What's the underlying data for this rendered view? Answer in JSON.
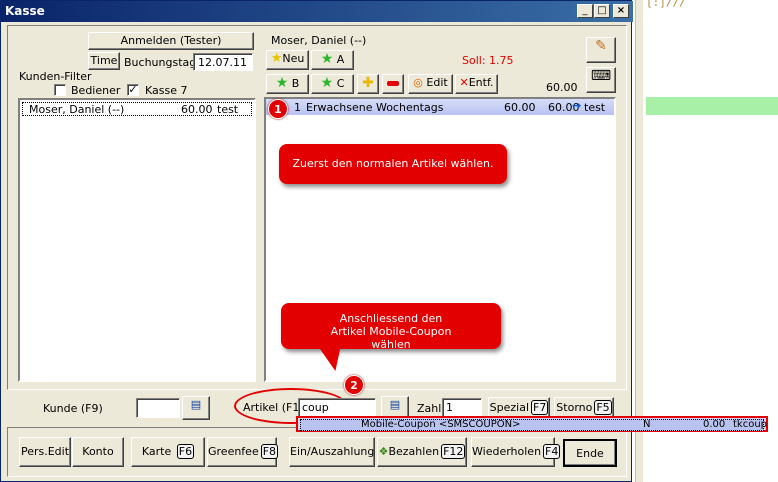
{
  "window": {
    "title": "Kasse",
    "controls": [
      "_",
      "□",
      "×"
    ]
  },
  "background_text": "[:]///",
  "left": {
    "anmelden_label": "Anmelden (Tester)",
    "time_label": "Time",
    "buchungstag_label": "Buchungstag",
    "buchungstag_value": "12.07.11",
    "kunden_filter_label": "Kunden-Filter",
    "bediener_label": "Bediener",
    "bediener_checked": false,
    "kasse_label": "Kasse 7",
    "kasse_checked": true,
    "customers": [
      {
        "name": "Moser, Daniel (--)",
        "amount": "60.00",
        "user": "test"
      }
    ]
  },
  "right": {
    "customer_name": "Moser, Daniel (--)",
    "soll_label": "Soll: 1.75",
    "total": "60.00",
    "buttons": {
      "neu": "Neu",
      "a": "A",
      "b": "B",
      "c": "C",
      "edit": "Edit",
      "entf": "Entf."
    },
    "items": [
      {
        "qty": "1",
        "name": "Erwachsene Wochentags",
        "price": "60.00",
        "total": "60.00",
        "user": "test"
      }
    ]
  },
  "annotations": {
    "bubble1": "Zuerst den normalen Artikel wählen.",
    "bubble2": "Anschliessend den Artikel Mobile-Coupon wählen",
    "badge1": "1",
    "badge2": "2"
  },
  "input_row": {
    "kunde_label": "Kunde (F9)",
    "kunde_value": "",
    "artikel_label": "Artikel (F1)",
    "artikel_value": "coup",
    "zahl_label": "Zahl",
    "zahl_value": "1",
    "spezial_label": "Spezial",
    "spezial_key": "F7",
    "storno_label": "Storno",
    "storno_key": "F5"
  },
  "dropdown": {
    "name": "Mobile-Coupon  <SMSCOUPON>",
    "flag": "N",
    "price": "0.00",
    "code": "tkcoup"
  },
  "bottom": {
    "pers_edit": "Pers.Edit",
    "konto": "Konto",
    "karte": "Karte",
    "karte_key": "F6",
    "greenfee": "Greenfee",
    "greenfee_key": "F8",
    "einauszahlung": "Ein/Auszahlung",
    "bezahlen": "Bezahlen",
    "bezahlen_key": "F12",
    "wiederholen": "Wiederholen",
    "wiederholen_key": "F4",
    "ende": "Ende"
  },
  "colors": {
    "titlebar": "#0a246a",
    "window_bg": "#ece9d8",
    "highlight_red": "#e30000",
    "selection_blue": "#b9c3f0",
    "side_green": "#a8f0a8"
  }
}
